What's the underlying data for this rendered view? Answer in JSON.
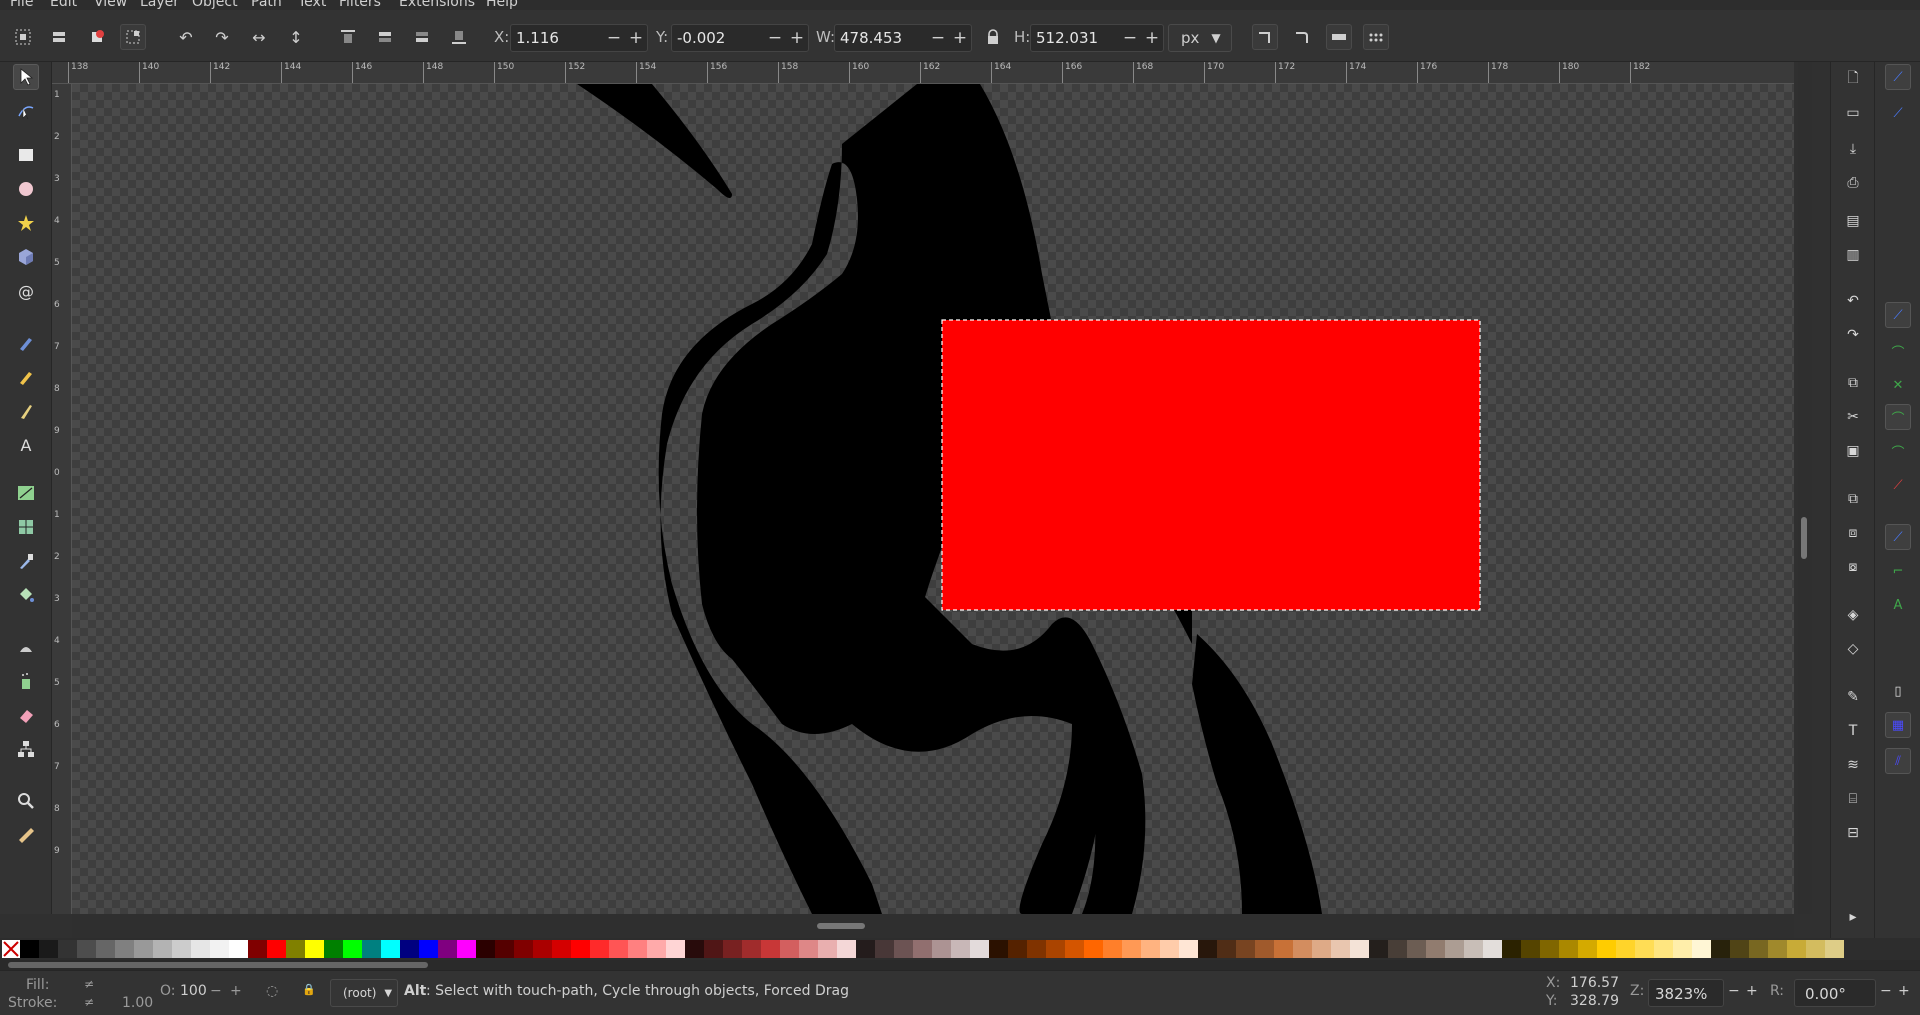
{
  "menu": [
    "File",
    "Edit",
    "View",
    "Layer",
    "Object",
    "Path",
    "Text",
    "Filters",
    "Extensions",
    "Help"
  ],
  "toolbar": {
    "x_label": "X:",
    "x_value": "1.116",
    "y_label": "Y:",
    "y_value": "-0.002",
    "w_label": "W:",
    "w_value": "478.453",
    "h_label": "H:",
    "h_value": "512.031",
    "unit": "px",
    "minus": "−",
    "plus": "+"
  },
  "ruler_top_labels": [
    "138",
    "140",
    "142",
    "144",
    "146",
    "148",
    "150",
    "152",
    "154",
    "156",
    "158",
    "160",
    "162",
    "164",
    "166",
    "168",
    "170",
    "172",
    "174",
    "176",
    "178",
    "180",
    "182"
  ],
  "ruler_left_labels": [
    "1",
    "2",
    "3",
    "4",
    "5",
    "6",
    "7",
    "8",
    "9",
    "0",
    "1",
    "2",
    "3",
    "4",
    "5",
    "6",
    "7",
    "8",
    "9"
  ],
  "canvas": {
    "selected_rect_color": "#ff0000",
    "shape_color": "#000000"
  },
  "palette": [
    "#ffffff",
    "#000000",
    "#1a1a1a",
    "#333333",
    "#4d4d4d",
    "#666666",
    "#808080",
    "#999999",
    "#b3b3b3",
    "#cccccc",
    "#e6e6e6",
    "#f2f2f2",
    "#ffffff",
    "#800000",
    "#ff0000",
    "#808000",
    "#ffff00",
    "#008000",
    "#00ff00",
    "#008080",
    "#00ffff",
    "#000080",
    "#0000ff",
    "#800080",
    "#ff00ff",
    "#2b0000",
    "#550000",
    "#800000",
    "#aa0000",
    "#d40000",
    "#ff0000",
    "#ff2a2a",
    "#ff5555",
    "#ff8080",
    "#ffaaaa",
    "#ffd5d5",
    "#280b0b",
    "#501616",
    "#782121",
    "#a02c2c",
    "#c83737",
    "#d35f5f",
    "#de8787",
    "#e9afaf",
    "#f4d7d7",
    "#241c1c",
    "#483737",
    "#6c5353",
    "#916f6f",
    "#ac9393",
    "#c8b7b7",
    "#e3dbdb",
    "#2b1100",
    "#552200",
    "#803300",
    "#aa4400",
    "#d45500",
    "#ff6600",
    "#ff7f2a",
    "#ff9955",
    "#ffb380",
    "#ffccaa",
    "#ffe6d5",
    "#28170b",
    "#502d16",
    "#784421",
    "#a05a2c",
    "#c87137",
    "#d38d5f",
    "#deaa87",
    "#e9c6af",
    "#f4e3d7",
    "#241f1c",
    "#483e37",
    "#6c5d53",
    "#917c6f",
    "#ac9d93",
    "#c8beb7",
    "#e3dedb",
    "#2b2200",
    "#554400",
    "#806600",
    "#aa8800",
    "#d4aa00",
    "#ffcc00",
    "#ffd42a",
    "#ffdd55",
    "#ffe680",
    "#ffeeaa",
    "#fff6d5",
    "#28220b",
    "#504416",
    "#786721",
    "#a0892c",
    "#c8ab37",
    "#d3bc5f",
    "#decd87"
  ],
  "status": {
    "fill_label": "Fill:",
    "fill_value": "≠",
    "stroke_label": "Stroke:",
    "stroke_value": "≠",
    "stroke_width": "1.00",
    "opacity_label": "O:",
    "opacity_value": "100",
    "layer": "(root)",
    "message_key": "Alt",
    "message": ": Select with touch-path, Cycle through objects, Forced Drag",
    "cursor_x_label": "X:",
    "cursor_x": "176.57",
    "cursor_y_label": "Y:",
    "cursor_y": "328.79",
    "zoom_label": "Z:",
    "zoom": "3823%",
    "rotation_label": "R:",
    "rotation": "0.00°"
  }
}
